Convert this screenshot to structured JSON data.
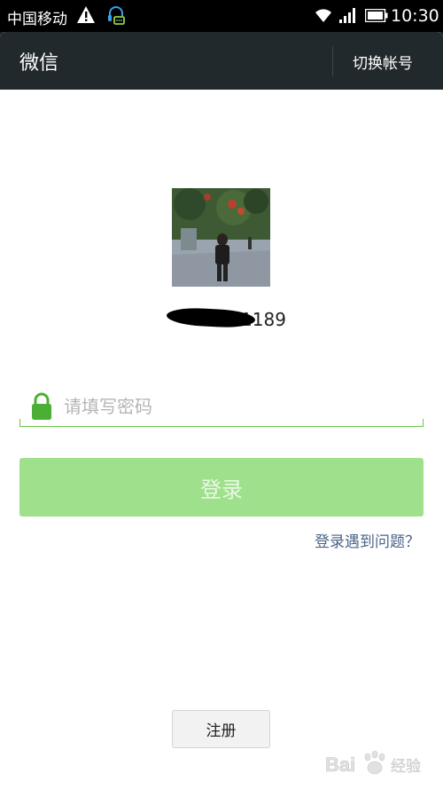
{
  "status_bar": {
    "carrier": "中国移动",
    "time": "10:30",
    "icons": [
      "warning-icon",
      "headset-icon",
      "wifi-icon",
      "signal-icon",
      "battery-icon"
    ]
  },
  "action_bar": {
    "title": "微信",
    "switch_account": "切换帐号"
  },
  "profile": {
    "account_visible": "1189"
  },
  "password": {
    "placeholder": "请填写密码",
    "value": ""
  },
  "login_button": "登录",
  "help_link": "登录遇到问题？",
  "register_button": "注册",
  "watermark": "Bai 经验",
  "colors": {
    "action_bar": "#22292c",
    "accent_green": "#6cc24a",
    "login_button": "#9fe08c",
    "link": "#4a6489"
  }
}
